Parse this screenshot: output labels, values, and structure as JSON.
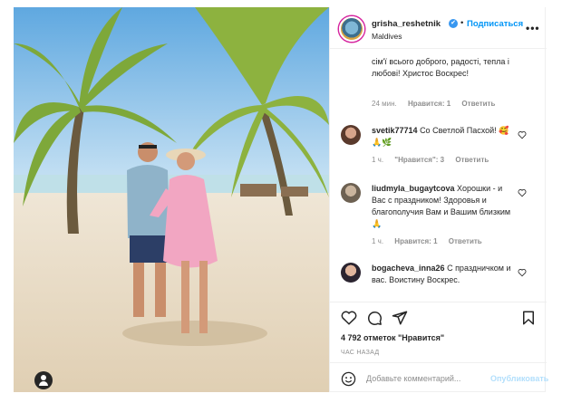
{
  "post": {
    "author": "grisha_reshetnik",
    "verified_mark": "✔",
    "separator": "•",
    "follow_label": "Подписаться",
    "location": "Maldives",
    "more_label": "•••"
  },
  "comments": [
    {
      "user": "",
      "text": "сім'ї всього доброго, радості, тепла і любові! Христос Воскрес!",
      "time": "24 мин.",
      "likes": "Нравится: 1",
      "reply": "Ответить"
    },
    {
      "user": "svetik77714",
      "text": "Со Светлой Пасхой! 🥰🙏🌿",
      "time": "1 ч.",
      "likes": "\"Нравится\": 3",
      "reply": "Ответить"
    },
    {
      "user": "liudmyla_bugaytcova",
      "text": "Хорошки - и Вас с праздником! Здоровья и благополучия Вам и Вашим близким🙏",
      "time": "1 ч.",
      "likes": "Нравится: 1",
      "reply": "Ответить"
    },
    {
      "user": "bogacheva_inna26",
      "text": "С праздничком и вас. Воистину Воскрес.",
      "time": "",
      "likes": "",
      "reply": ""
    }
  ],
  "actions": {
    "likes_text": "4 792 отметок \"Нравится\"",
    "time_text": "ЧАС НАЗАД"
  },
  "comment_box": {
    "placeholder": "Добавьте комментарий...",
    "publish_label": "Опубликовать"
  },
  "colors": {
    "link_blue": "#0095f6",
    "publish_disabled": "#b2dffc",
    "muted": "#8e8e8e",
    "text": "#262626"
  }
}
